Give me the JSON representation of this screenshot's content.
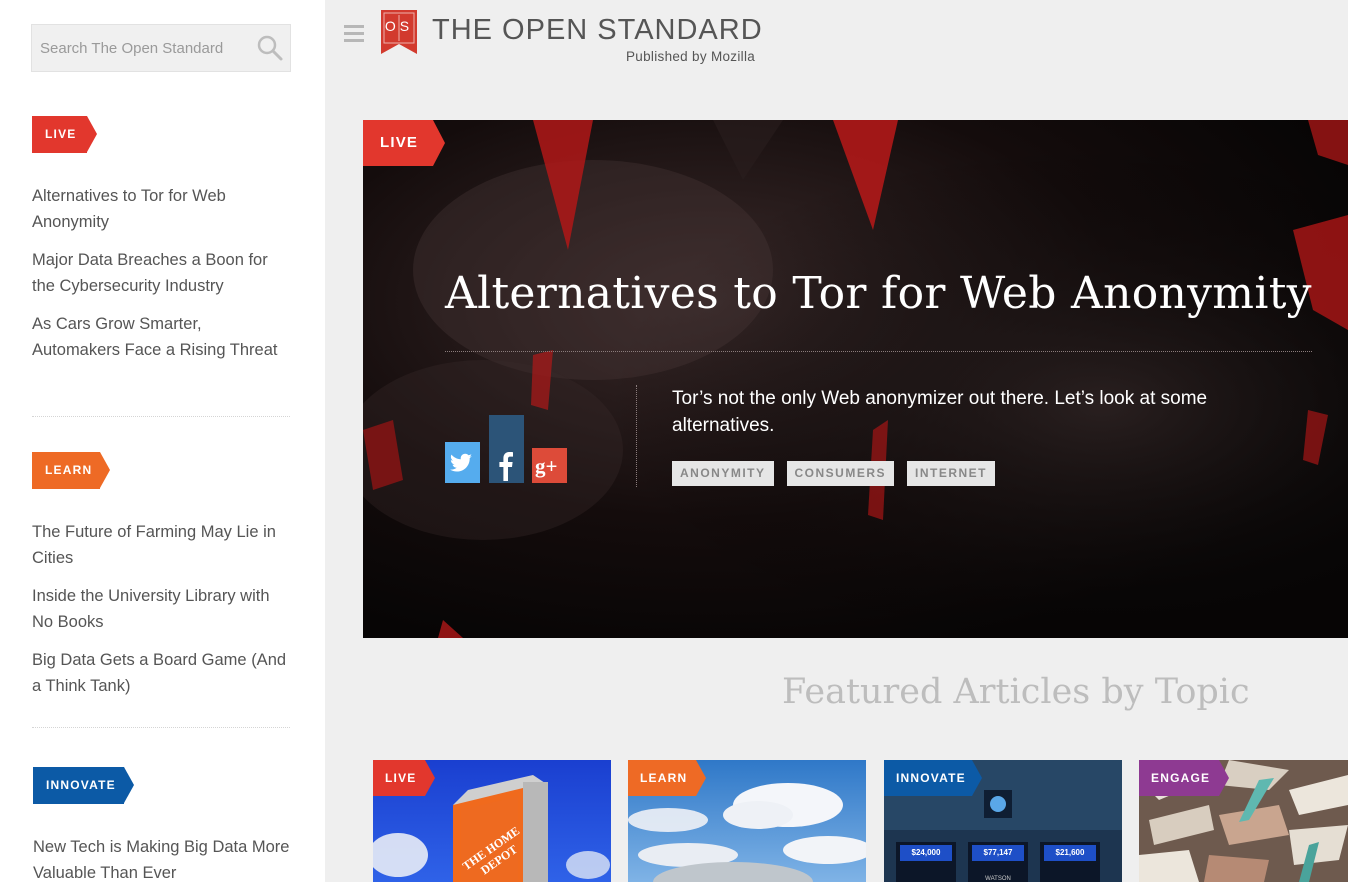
{
  "search": {
    "placeholder": "Search The Open Standard"
  },
  "site": {
    "logo_letters": "OS",
    "title": "THE OPEN STANDARD",
    "subtitle": "Published by Mozilla"
  },
  "colors": {
    "live": "#e2372d",
    "learn": "#ee6a25",
    "innovate": "#0c5aa6",
    "engage": "#8e3a92"
  },
  "sidebar": {
    "sections": [
      {
        "label": "LIVE",
        "items": [
          "Alternatives to Tor for Web Anonymity",
          "Major Data Breaches a Boon for the Cybersecurity Industry",
          "As Cars Grow Smarter, Automakers Face a Rising Threat"
        ]
      },
      {
        "label": "LEARN",
        "items": [
          "The Future of Farming May Lie in Cities",
          "Inside the University Library with No Books",
          "Big Data Gets a Board Game (And a Think Tank)"
        ]
      },
      {
        "label": "INNOVATE",
        "items": [
          "New Tech is Making Big Data More Valuable Than Ever"
        ]
      }
    ]
  },
  "hero": {
    "badge": "LIVE",
    "title": "Alternatives to Tor for Web Anonymity",
    "description": "Tor’s not the only Web anonymizer out there. Let’s look at some alternatives.",
    "tags": [
      "ANONYMITY",
      "CONSUMERS",
      "INTERNET"
    ],
    "share_icons": [
      "twitter-icon",
      "facebook-icon",
      "google-plus-icon"
    ]
  },
  "featured": {
    "heading": "Featured Articles by Topic",
    "cards": [
      {
        "badge": "LIVE",
        "sign_text": "THE HOME DEPOT"
      },
      {
        "badge": "LEARN"
      },
      {
        "badge": "INNOVATE",
        "scores": [
          "$24,000",
          "$77,147",
          "$21,600"
        ],
        "podium_label": "WATSON"
      },
      {
        "badge": "ENGAGE"
      }
    ]
  }
}
